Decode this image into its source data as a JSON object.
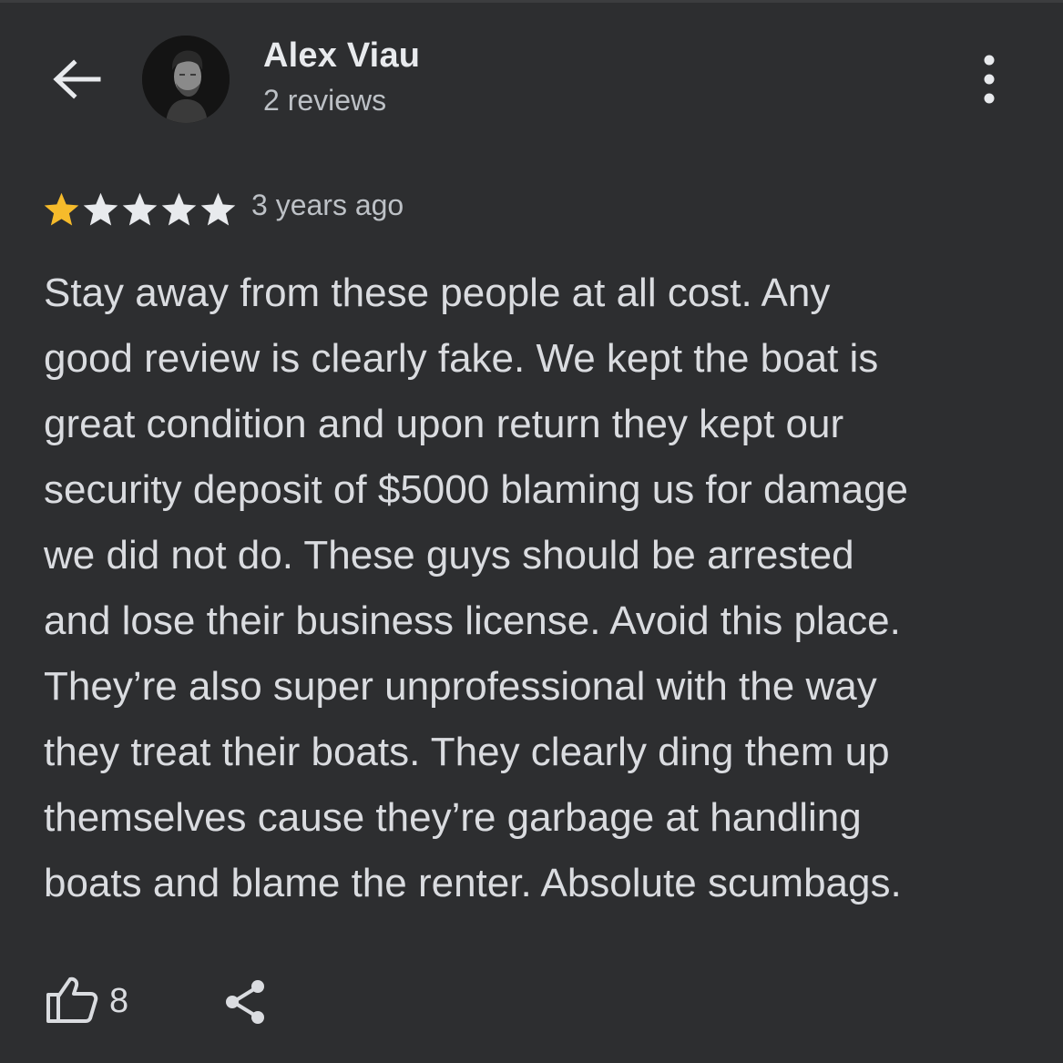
{
  "header": {
    "back_icon": "arrow-back-icon",
    "author_name": "Alex Viau",
    "author_reviews": "2 reviews",
    "more_icon": "more-vert-icon"
  },
  "review": {
    "rating": 1,
    "rating_max": 5,
    "time": "3 years ago",
    "text": "Stay away from these people at all cost. Any\ngood review is clearly fake. We kept the boat is\ngreat condition and upon return they kept our\nsecurity deposit of $5000 blaming us for damage\nwe did not do. These guys should be arrested\nand lose their business license. Avoid this place.\nThey’re also super unprofessional with the way\nthey treat their boats. They clearly ding them up\nthemselves cause they’re garbage at handling\nboats and blame the renter. Absolute scumbags."
  },
  "actions": {
    "like_icon": "thumbs-up-icon",
    "like_count": "8",
    "share_icon": "share-icon"
  },
  "colors": {
    "background": "#2d2e30",
    "star_filled": "#f6bb2b",
    "star_empty": "#e8eaed",
    "text_primary": "#dadce0",
    "text_secondary": "#bdc1c6"
  }
}
